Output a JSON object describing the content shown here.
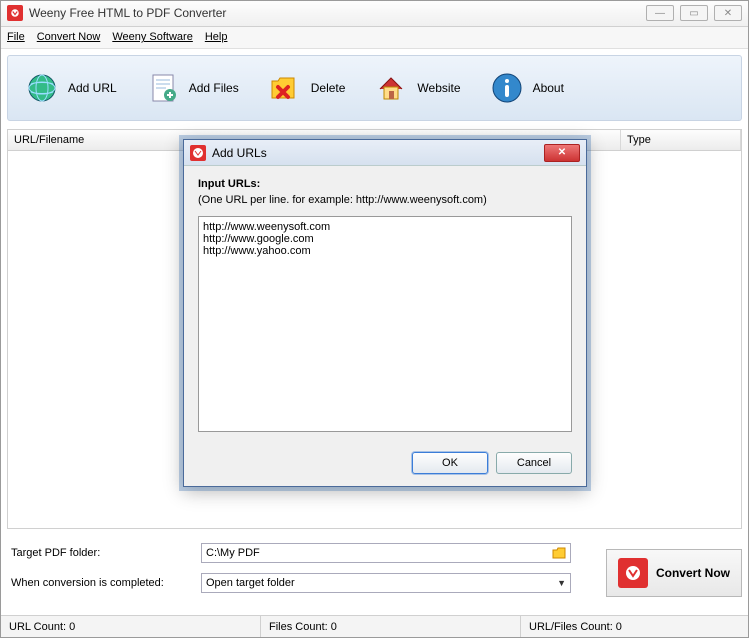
{
  "window": {
    "title": "Weeny Free HTML to PDF Converter"
  },
  "menu": {
    "file": "File",
    "convert": "Convert Now",
    "weeny": "Weeny Software",
    "help": "Help"
  },
  "toolbar": {
    "addurl": "Add URL",
    "addfiles": "Add Files",
    "delete": "Delete",
    "website": "Website",
    "about": "About"
  },
  "list": {
    "col_url": "URL/Filename",
    "col_type": "Type"
  },
  "settings": {
    "target_label": "Target PDF folder:",
    "target_value": "C:\\My PDF",
    "when_label": "When conversion is completed:",
    "when_value": "Open target folder"
  },
  "convert": {
    "label": "Convert Now"
  },
  "status": {
    "urlcount": "URL Count: 0",
    "filescount": "Files Count: 0",
    "total": "URL/Files Count: 0"
  },
  "dialog": {
    "title": "Add URLs",
    "heading": "Input URLs:",
    "hint": "(One URL per line. for example: http://www.weenysoft.com)",
    "text": "http://www.weenysoft.com\nhttp://www.google.com\nhttp://www.yahoo.com",
    "ok": "OK",
    "cancel": "Cancel"
  }
}
